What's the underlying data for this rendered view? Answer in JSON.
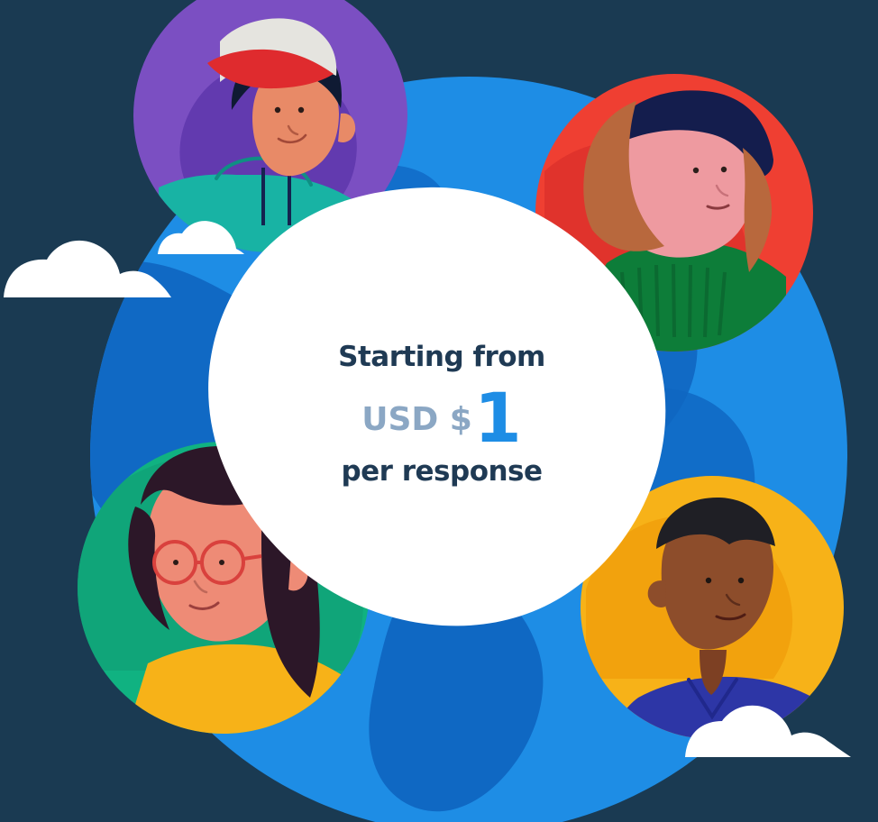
{
  "promo": {
    "line1": "Starting from",
    "currency": "USD $",
    "amount": "1",
    "line3": "per response"
  },
  "colors": {
    "background": "#1a3a52",
    "globe": "#1e8de5",
    "amount": "#1e8de5",
    "currency": "#8ba7c4",
    "text": "#1f3a54",
    "purple_circle": "#7b4fc2",
    "red_circle": "#ef3f32",
    "green_circle": "#10b281",
    "yellow_circle": "#f7b218"
  },
  "illustrations": [
    "person-with-cap-icon",
    "person-with-beanie-icon",
    "person-with-glasses-icon",
    "person-in-collared-shirt-icon"
  ]
}
